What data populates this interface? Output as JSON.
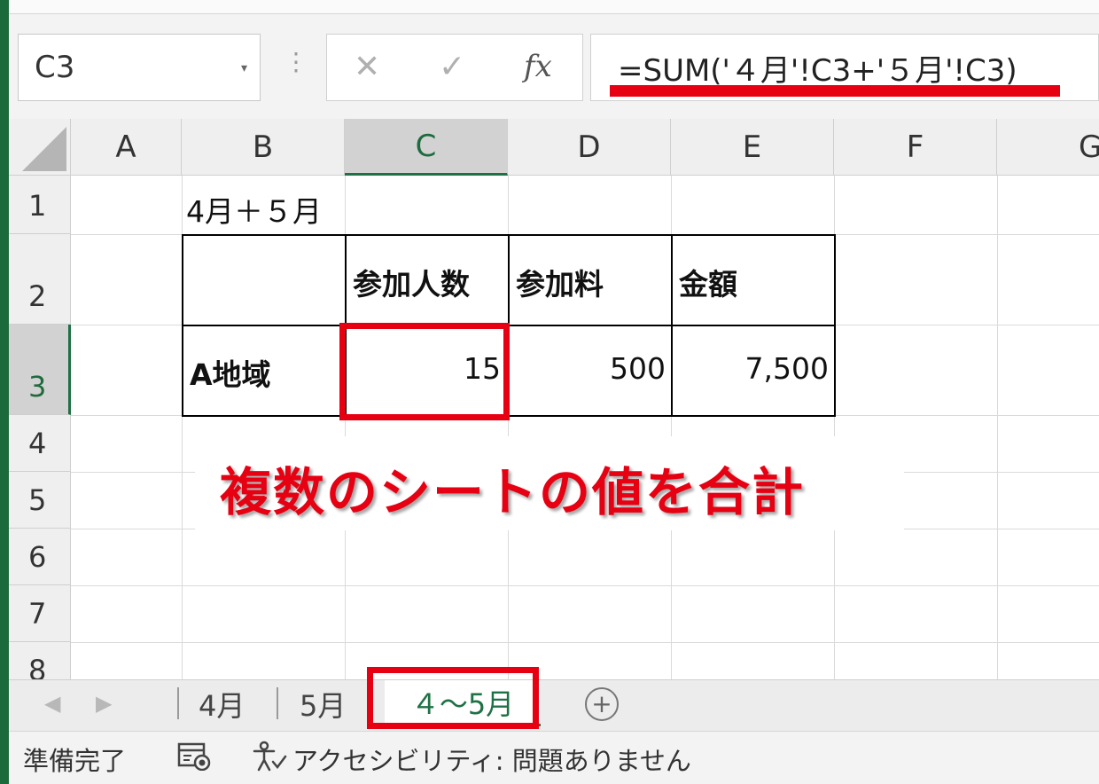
{
  "formula_bar": {
    "name_box": "C3",
    "dropdown_glyph": "▾",
    "dots_glyph": "⋮",
    "cancel_glyph": "✕",
    "enter_glyph": "✓",
    "fx_label": "fx",
    "formula": "=SUM('４月'!C3+'５月'!C3)"
  },
  "grid": {
    "columns": [
      "A",
      "B",
      "C",
      "D",
      "E",
      "F",
      "G"
    ],
    "active_column": "C",
    "rows": [
      "1",
      "2",
      "3",
      "4",
      "5",
      "6",
      "7",
      "8"
    ],
    "active_row": "3",
    "cells": {
      "B1": "4月＋５月",
      "C2": "参加人数",
      "D2": "参加料",
      "E2": "金額",
      "B3": "A地域",
      "C3": "15",
      "D3": "500",
      "E3": "7,500"
    }
  },
  "annotation": {
    "callout": "複数のシートの値を合計",
    "color": "#e60012"
  },
  "sheet_tabs": {
    "prev_glyph": "◀",
    "next_glyph": "▶",
    "tabs": [
      "4月",
      "5月",
      "４～5月"
    ],
    "active_tab": "４～5月",
    "add_glyph": "+"
  },
  "status_bar": {
    "ready": "準備完了",
    "accessibility": "アクセシビリティ: 問題ありません"
  },
  "colors": {
    "excel_green": "#1e7145",
    "highlight_red": "#e60012"
  }
}
